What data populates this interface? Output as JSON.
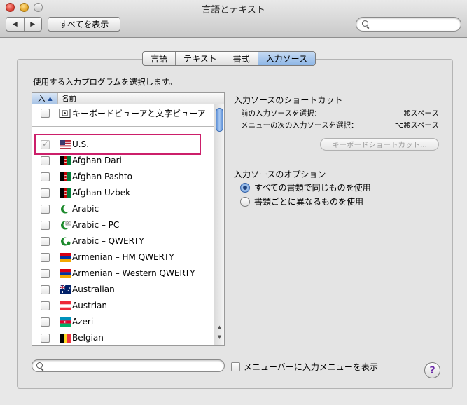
{
  "window": {
    "title": "言語とテキスト"
  },
  "toolbar": {
    "show_all_label": "すべてを表示",
    "back_icon": "◀",
    "forward_icon": "▶"
  },
  "tabs": [
    {
      "label": "言語",
      "active": false
    },
    {
      "label": "テキスト",
      "active": false
    },
    {
      "label": "書式",
      "active": false
    },
    {
      "label": "入力ソース",
      "active": true
    }
  ],
  "instruction": "使用する入力プログラムを選択します。",
  "list": {
    "header_in": "入",
    "header_sort": "▲",
    "header_name": "名前",
    "items": [
      {
        "label": "キーボードビューアと文字ビューア",
        "checked": false,
        "icon": "keyboard-viewer-icon"
      },
      {
        "label": "U.S.",
        "checked": true,
        "disabled": true,
        "icon": "us-flag-icon"
      },
      {
        "label": "Afghan Dari",
        "checked": false,
        "icon": "afghanistan-flag-icon"
      },
      {
        "label": "Afghan Pashto",
        "checked": false,
        "icon": "afghanistan-flag-icon"
      },
      {
        "label": "Afghan Uzbek",
        "checked": false,
        "icon": "afghanistan-flag-icon"
      },
      {
        "label": "Arabic",
        "checked": false,
        "icon": "crescent-icon"
      },
      {
        "label": "Arabic – PC",
        "checked": false,
        "icon": "crescent-pc-icon"
      },
      {
        "label": "Arabic – QWERTY",
        "checked": false,
        "icon": "crescent-icon"
      },
      {
        "label": "Armenian – HM QWERTY",
        "checked": false,
        "icon": "armenia-flag-icon"
      },
      {
        "label": "Armenian – Western QWERTY",
        "checked": false,
        "icon": "armenia-flag-icon"
      },
      {
        "label": "Australian",
        "checked": false,
        "icon": "australia-flag-icon"
      },
      {
        "label": "Austrian",
        "checked": false,
        "icon": "austria-flag-icon"
      },
      {
        "label": "Azeri",
        "checked": false,
        "icon": "azerbaijan-flag-icon"
      },
      {
        "label": "Belgian",
        "checked": false,
        "icon": "belgium-flag-icon"
      }
    ]
  },
  "shortcuts": {
    "heading": "入力ソースのショートカット",
    "prev_label": "前の入力ソースを選択：",
    "prev_key": "⌘スペース",
    "next_label": "メニューの次の入力ソースを選択：",
    "next_key": "⌥⌘スペース",
    "button_label": "キーボードショートカット..."
  },
  "options": {
    "heading": "入力ソースのオプション",
    "radio_same": "すべての書類で同じものを使用",
    "radio_each": "書類ごとに異なるものを使用",
    "selected": "same"
  },
  "bottom": {
    "show_menu_label": "メニューバーに入力メニューを表示",
    "help": "?"
  }
}
